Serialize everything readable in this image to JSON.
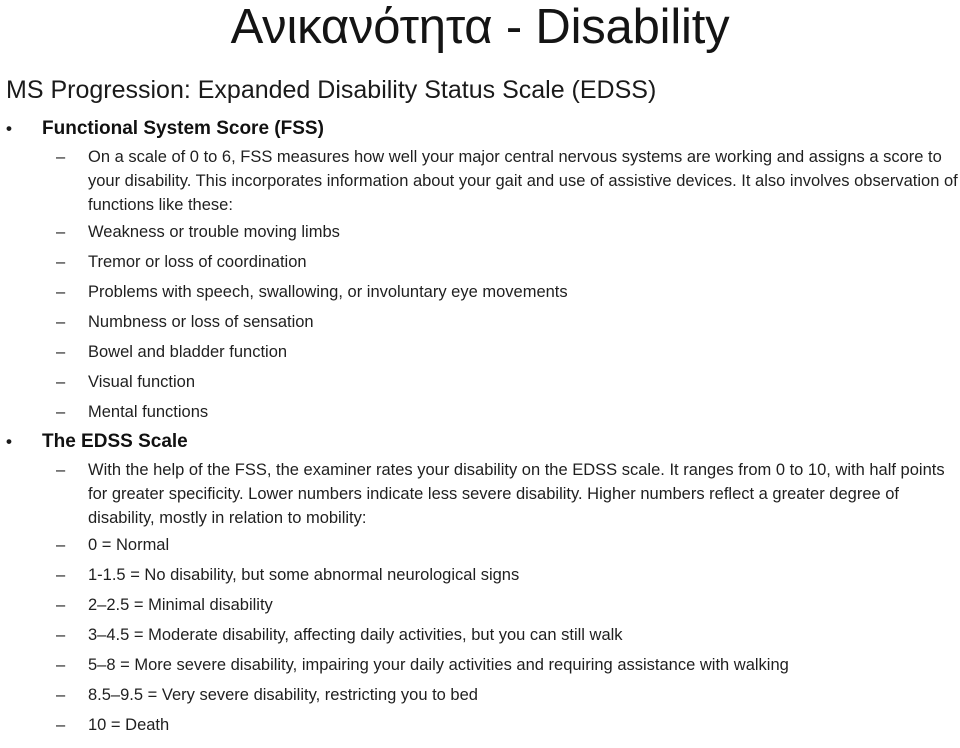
{
  "slide": {
    "title_greek": "Ανικανότητα - Disability",
    "subtitle": "MS Progression: Expanded Disability Status Scale (EDSS)",
    "bullet_marker": "•",
    "dash_marker": "–",
    "background_color": "#ffffff",
    "text_color": "#1a1a1a"
  },
  "outline": {
    "fss_heading": "Functional System Score (FSS)",
    "fss_intro": "On a scale of 0 to 6, FSS measures how well your major central nervous systems are working and assigns a score to your disability. This incorporates information about your gait and use of assistive devices. It also involves observation of functions like these:",
    "fss_functions": [
      "Weakness or trouble moving limbs",
      "Tremor or loss of coordination",
      "Problems with speech, swallowing, or involuntary eye movements",
      "Numbness or loss of sensation",
      "Bowel and bladder function",
      "Visual function",
      "Mental functions"
    ],
    "edss_heading": "The EDSS Scale",
    "edss_intro": "With the help of the FSS, the examiner rates your disability on the EDSS scale. It ranges from 0 to 10, with half points for greater specificity. Lower numbers indicate less severe disability. Higher numbers reflect a greater degree of disability, mostly in relation to mobility:",
    "edss_levels": [
      "0 = Normal",
      "1-1.5 = No disability, but some abnormal neurological signs",
      "2–2.5 = Minimal disability",
      "3–4.5 = Moderate disability, affecting daily activities, but you can still walk",
      "5–8 = More severe disability, impairing your daily activities and requiring assistance with walking",
      "8.5–9.5 = Very severe disability, restricting you to bed",
      "10 = Death"
    ]
  }
}
